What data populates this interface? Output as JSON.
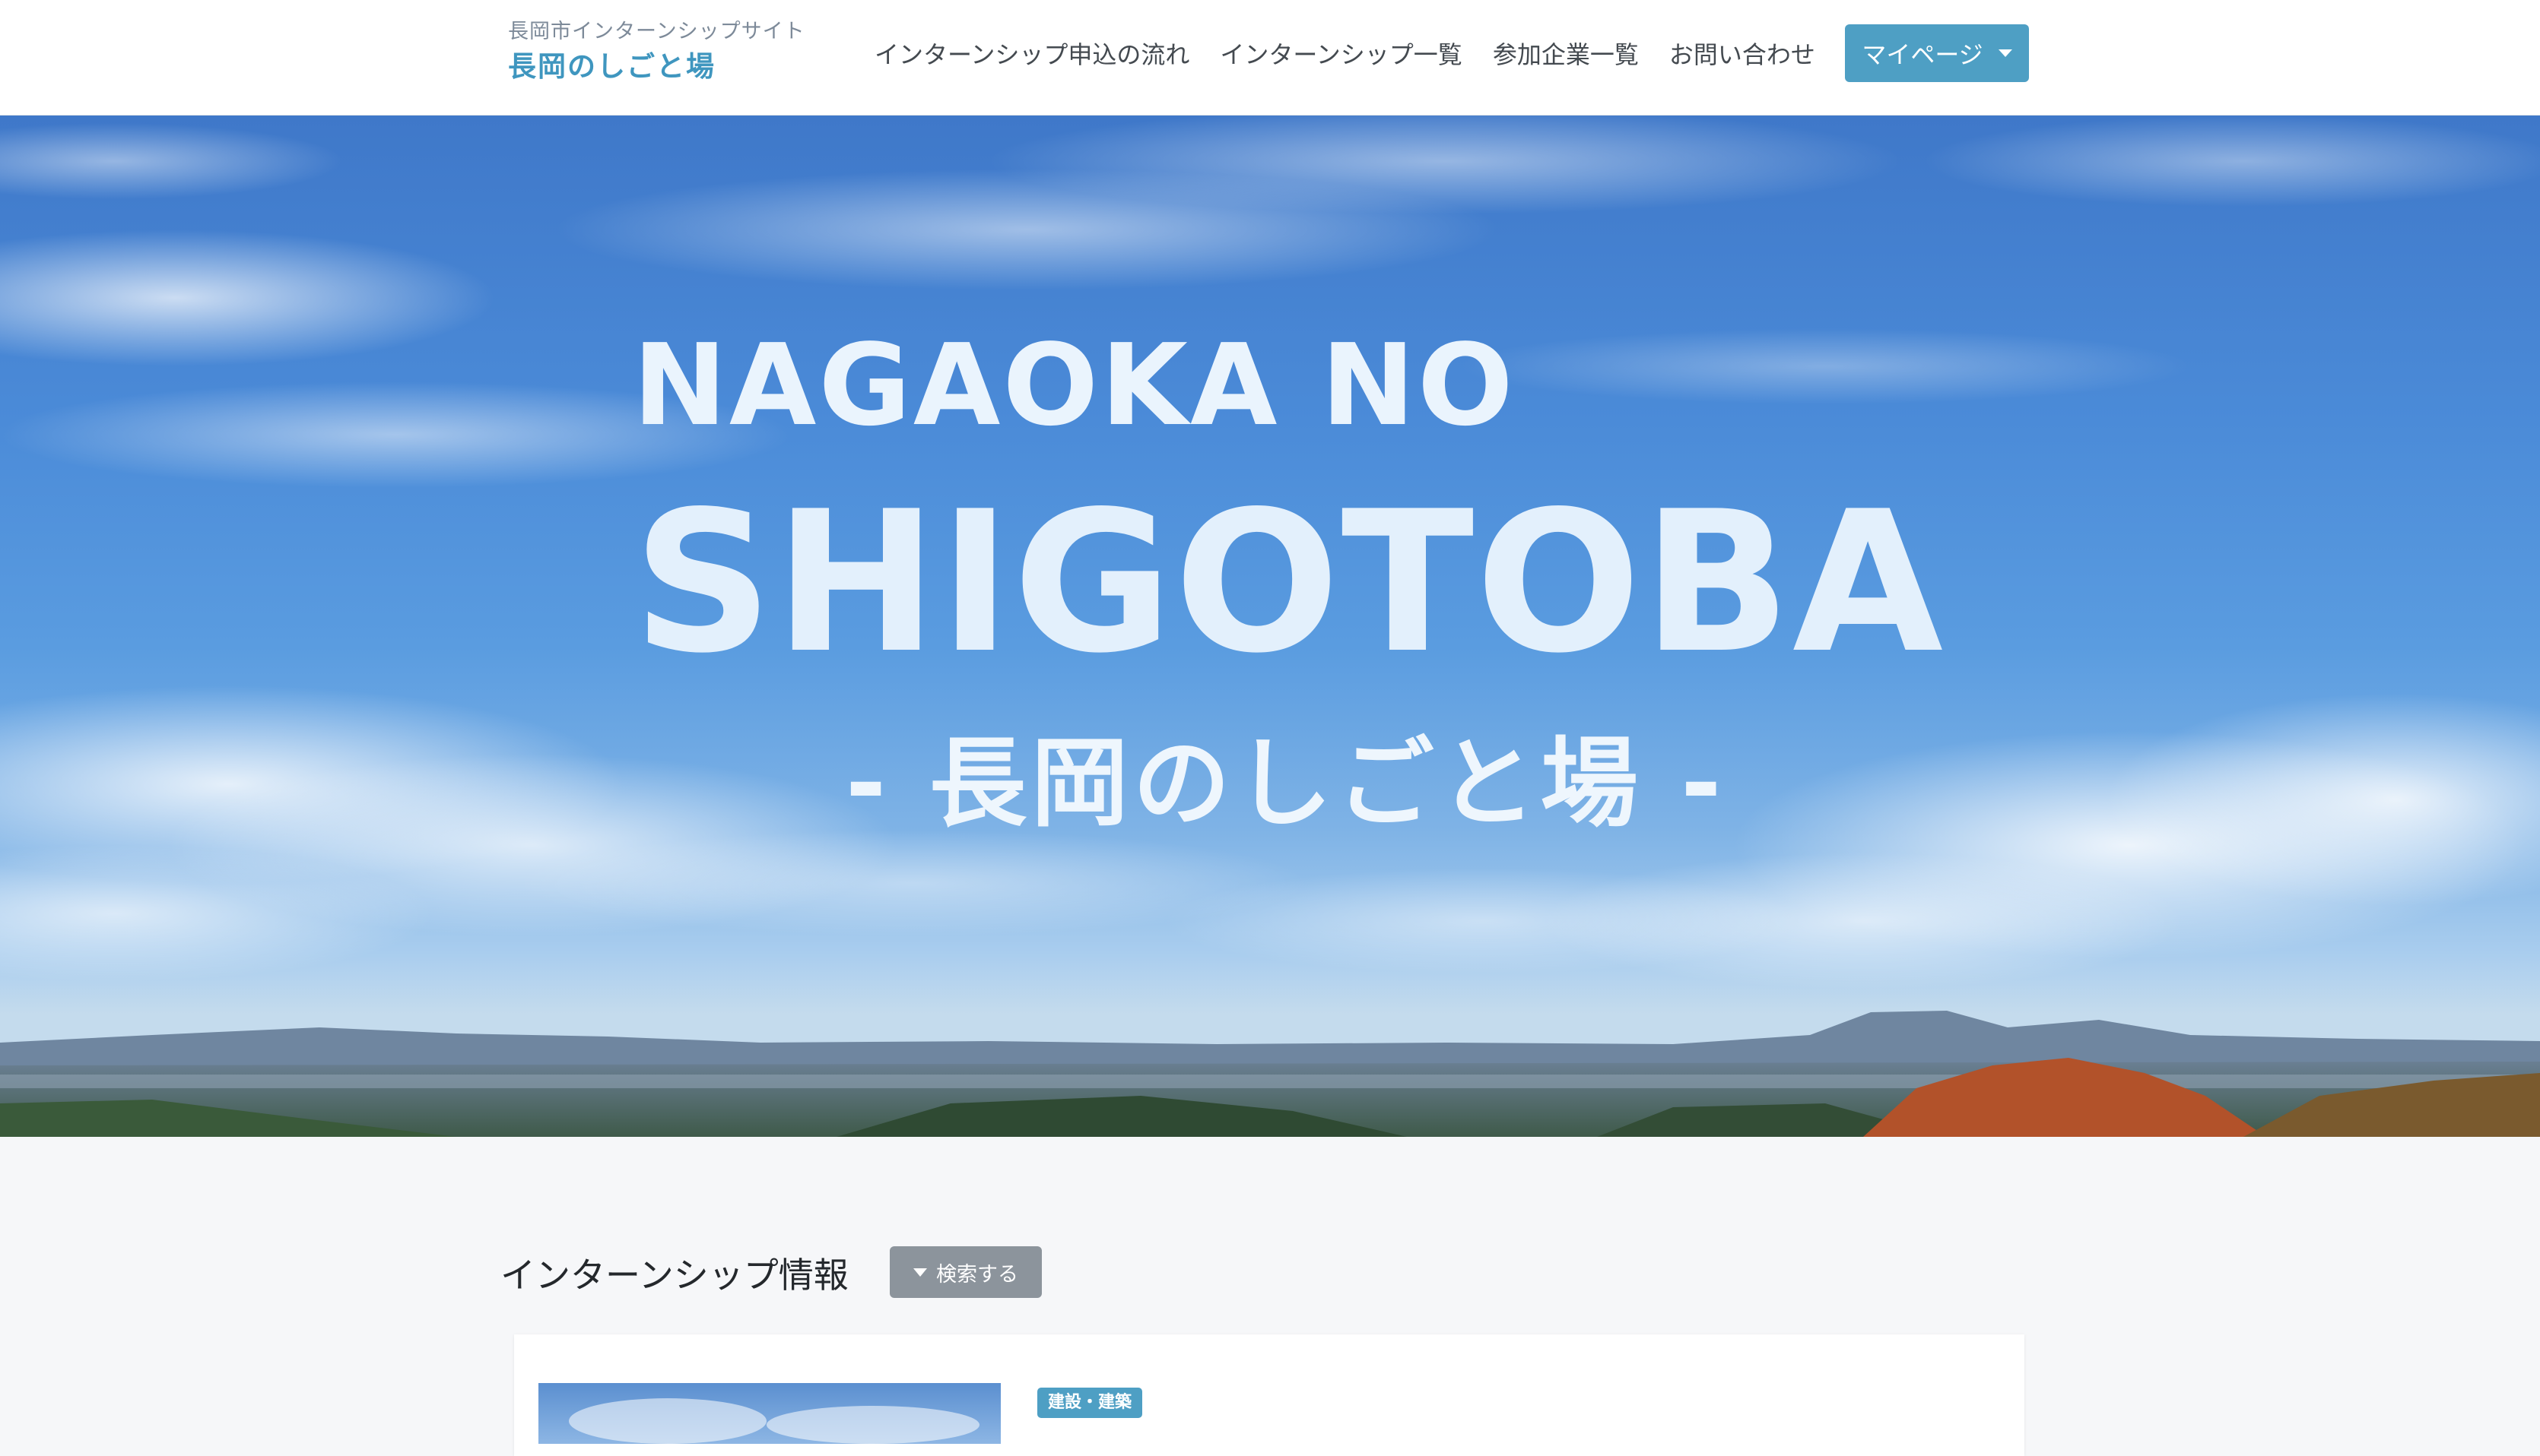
{
  "header": {
    "site_subtitle": "長岡市インターンシップサイト",
    "site_title": "長岡のしごと場",
    "nav": [
      {
        "label": "インターンシップ申込の流れ"
      },
      {
        "label": "インターンシップ一覧"
      },
      {
        "label": "参加企業一覧"
      },
      {
        "label": "お問い合わせ"
      }
    ],
    "mypage_label": "マイページ"
  },
  "hero": {
    "line1": "NAGAOKA NO",
    "line2": "SHIGOTOBA",
    "line3": "- 長岡のしごと場 -"
  },
  "section": {
    "title": "インターンシップ情報",
    "search_label": "検索する"
  },
  "cards": [
    {
      "category": "建設・建築"
    }
  ],
  "colors": {
    "brand": "#3f96bf",
    "accent_button": "#4e9fc4",
    "secondary_button": "#8c949c"
  }
}
